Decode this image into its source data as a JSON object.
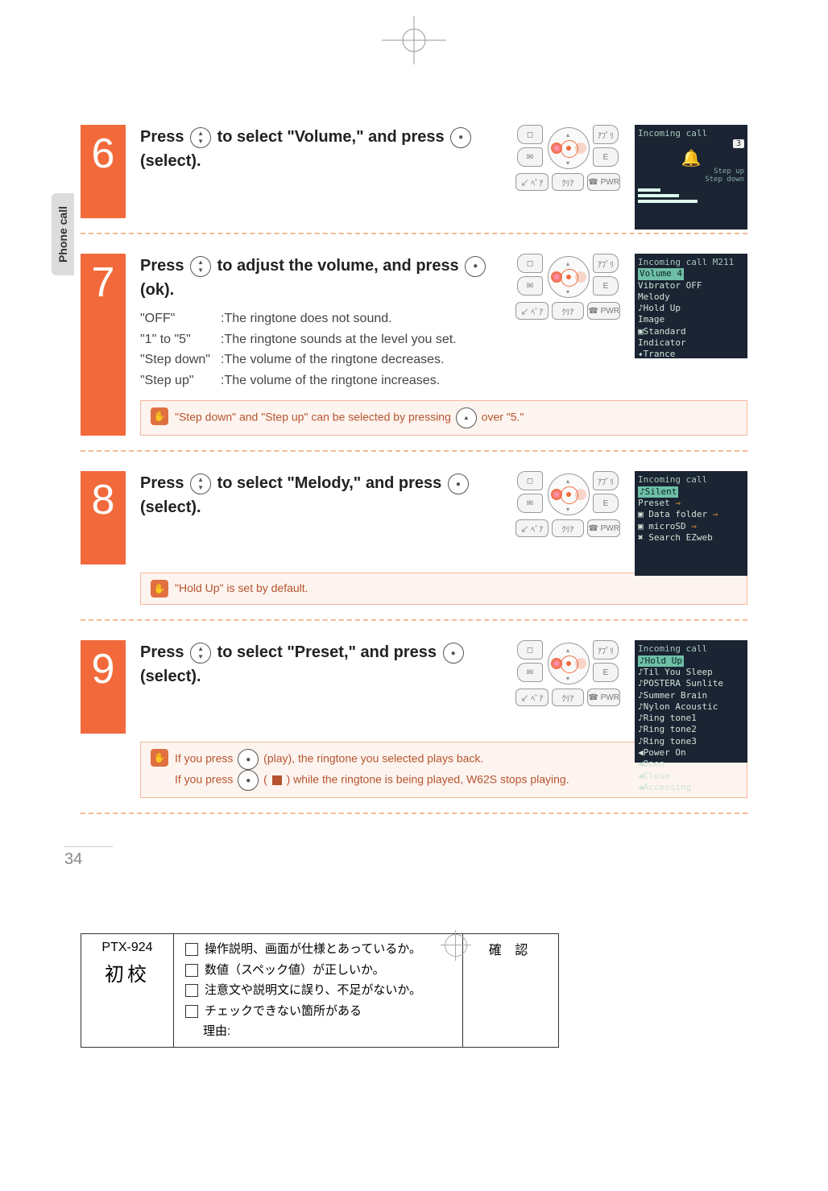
{
  "side_tab": "Phone call",
  "steps": {
    "s6": {
      "num": "6",
      "instr_a": "Press ",
      "instr_b": " to select \"Volume,\" and press ",
      "instr_c": " (select).",
      "screen": {
        "title": "Incoming call",
        "badge": "3",
        "sub1": "Step up",
        "sub2": "Step down"
      }
    },
    "s7": {
      "num": "7",
      "instr_a": "Press ",
      "instr_b": " to adjust the volume, and press ",
      "instr_c": " (ok).",
      "lines": [
        {
          "lbl": "\"OFF\"",
          "txt": ":The ringtone does not sound."
        },
        {
          "lbl": "\"1\" to \"5\"",
          "txt": ":The ringtone sounds at the level you set."
        },
        {
          "lbl": "\"Step down\"",
          "txt": ":The volume of the ringtone decreases."
        },
        {
          "lbl": "\"Step up\"",
          "txt": ":The volume of the ringtone increases."
        }
      ],
      "note": "\"Step down\" and \"Step up\" can be selected by pressing ",
      "note_tail": " over \"5.\"",
      "screen": {
        "title": "Incoming call   M211",
        "rows": [
          "Volume            4",
          "Vibrator        OFF",
          "Melody",
          "♪Hold Up",
          "Image",
          "▣Standard",
          "Indicator",
          "✦Trance"
        ],
        "hl_index": 0
      }
    },
    "s8": {
      "num": "8",
      "instr_a": "Press ",
      "instr_b": " to select \"Melody,\" and press ",
      "instr_c": " (select).",
      "note": "\"Hold Up\" is set by default.",
      "screen": {
        "title": "Incoming call",
        "rows": [
          "♪Silent",
          "  Preset",
          "▣ Data folder",
          "▣ microSD",
          "✖ Search EZweb"
        ],
        "hl_index": 0
      }
    },
    "s9": {
      "num": "9",
      "instr_a": "Press ",
      "instr_b": " to select \"Preset,\" and press ",
      "instr_c": " (select).",
      "note_l1a": "If you press ",
      "note_l1b": " (play), the ringtone you selected plays back.",
      "note_l2a": "If you press ",
      "note_l2b": " ( ",
      "note_l2c": " ) while the ringtone is being played, W62S stops playing.",
      "screen": {
        "title": "Incoming call",
        "rows": [
          "♪Hold Up",
          "♪Til You Sleep",
          "♪POSTERA Sunlite",
          "♪Summer Brain",
          "♪Nylon Acoustic",
          "♪Ring tone1",
          "♪Ring tone2",
          "♪Ring tone3",
          "◀Power On",
          "◀Open",
          "◀Close",
          "◀Accessing"
        ],
        "hl_index": 0
      }
    }
  },
  "keypad": {
    "tl": "◻",
    "tr": "ｱﾌﾟﾘ",
    "bl": "✉",
    "br": "E",
    "r3a": "↙ ﾍﾟｱ",
    "r3b": "ｸﾘｱ",
    "r3c": "☎ PWR"
  },
  "page_number": "34",
  "footer": {
    "code": "PTX-924",
    "jp": "初校",
    "checks": [
      "操作説明、画面が仕様とあっているか。",
      "数値（スペック値）が正しいか。",
      "注意文や説明文に誤り、不足がないか。",
      "チェックできない箇所がある"
    ],
    "reason_label": "理由:",
    "confirm": "確 認"
  }
}
